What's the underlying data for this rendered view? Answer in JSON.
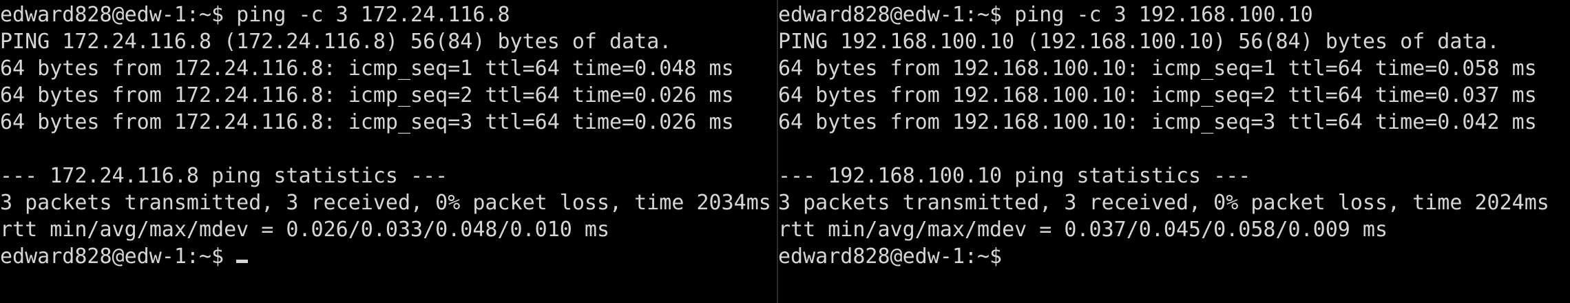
{
  "colors": {
    "background": "#000000",
    "foreground": "#d6d6d6",
    "divider": "#2b2b2b"
  },
  "left_pane": {
    "lines": [
      "edward828@edw-1:~$ ping -c 3 172.24.116.8",
      "PING 172.24.116.8 (172.24.116.8) 56(84) bytes of data.",
      "64 bytes from 172.24.116.8: icmp_seq=1 ttl=64 time=0.048 ms",
      "64 bytes from 172.24.116.8: icmp_seq=2 ttl=64 time=0.026 ms",
      "64 bytes from 172.24.116.8: icmp_seq=3 ttl=64 time=0.026 ms",
      "",
      "--- 172.24.116.8 ping statistics ---",
      "3 packets transmitted, 3 received, 0% packet loss, time 2034ms",
      "rtt min/avg/max/mdev = 0.026/0.033/0.048/0.010 ms"
    ],
    "prompt": "edward828@edw-1:~$ "
  },
  "right_pane": {
    "lines": [
      "edward828@edw-1:~$ ping -c 3 192.168.100.10",
      "PING 192.168.100.10 (192.168.100.10) 56(84) bytes of data.",
      "64 bytes from 192.168.100.10: icmp_seq=1 ttl=64 time=0.058 ms",
      "64 bytes from 192.168.100.10: icmp_seq=2 ttl=64 time=0.037 ms",
      "64 bytes from 192.168.100.10: icmp_seq=3 ttl=64 time=0.042 ms",
      "",
      "--- 192.168.100.10 ping statistics ---",
      "3 packets transmitted, 3 received, 0% packet loss, time 2024ms",
      "rtt min/avg/max/mdev = 0.037/0.045/0.058/0.009 ms"
    ],
    "prompt": "edward828@edw-1:~$"
  }
}
